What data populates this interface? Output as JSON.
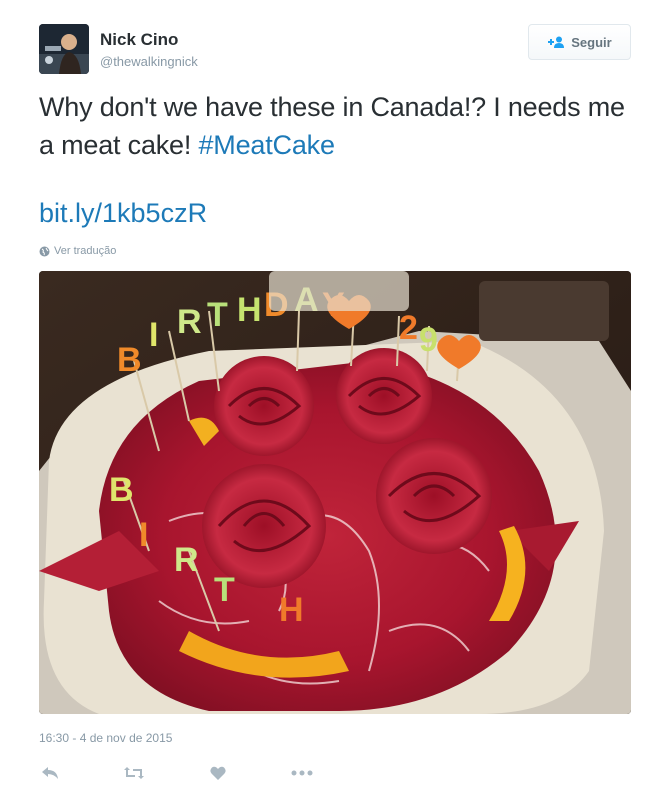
{
  "author": {
    "name": "Nick Cino",
    "handle": "@thewalkingnick"
  },
  "follow_button": {
    "label": "Seguir",
    "icon": "add-user-icon"
  },
  "tweet": {
    "text_part1": "Why don't we have these in Canada!? I needs me a meat cake! ",
    "hashtag": "#MeatCake",
    "link": "bit.ly/1kb5czR",
    "translate_label": "Ver tradução",
    "translate_icon": "globe-icon"
  },
  "photo": {
    "description_icon": "meat-cake-photo",
    "candle_letters": [
      "B",
      "I",
      "R",
      "T",
      "H",
      "D",
      "A",
      "Y",
      "2",
      "9"
    ]
  },
  "timestamp": "16:30 - 4 de nov de 2015",
  "actions": [
    {
      "name": "reply",
      "icon": "reply-icon"
    },
    {
      "name": "retweet",
      "icon": "retweet-icon"
    },
    {
      "name": "like",
      "icon": "heart-icon"
    },
    {
      "name": "more",
      "icon": "more-icon"
    }
  ],
  "colors": {
    "link": "#1d7ab8",
    "muted": "#8899a6",
    "text": "#292f33"
  }
}
